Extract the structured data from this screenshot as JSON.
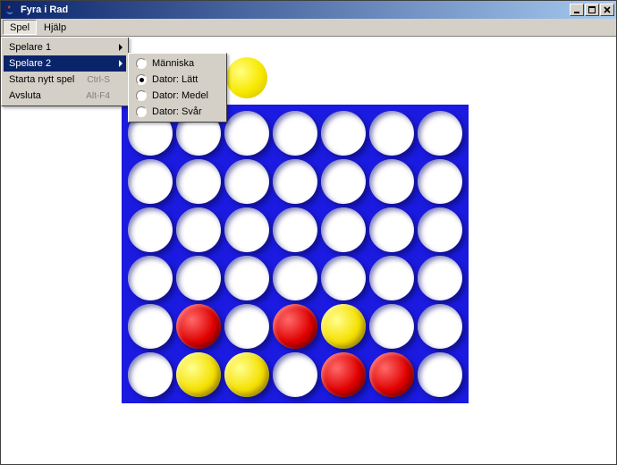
{
  "window": {
    "title": "Fyra i Rad"
  },
  "menubar": {
    "spel": "Spel",
    "hjalp": "Hjälp"
  },
  "spel_menu": {
    "player1": "Spelare 1",
    "player2": "Spelare 2",
    "new_game": "Starta nytt spel",
    "new_game_accel": "Ctrl-S",
    "quit": "Avsluta",
    "quit_accel": "Alt-F4"
  },
  "player2_submenu": {
    "human": "Människa",
    "easy": "Dator: Lätt",
    "medium": "Dator: Medel",
    "hard": "Dator: Svår",
    "selected": "easy"
  },
  "game": {
    "hover_column": 2,
    "hover_color": "yellow",
    "colors": {
      "board": "#1a1ae0",
      "red": "#e00000",
      "yellow": "#f5e000"
    },
    "board": [
      [
        "empty",
        "empty",
        "empty",
        "empty",
        "empty",
        "empty",
        "empty"
      ],
      [
        "empty",
        "empty",
        "empty",
        "empty",
        "empty",
        "empty",
        "empty"
      ],
      [
        "empty",
        "empty",
        "empty",
        "empty",
        "empty",
        "empty",
        "empty"
      ],
      [
        "empty",
        "empty",
        "empty",
        "empty",
        "empty",
        "empty",
        "empty"
      ],
      [
        "empty",
        "red",
        "empty",
        "red",
        "yellow",
        "empty",
        "empty"
      ],
      [
        "empty",
        "yellow",
        "yellow",
        "empty",
        "red",
        "red",
        "empty"
      ]
    ]
  }
}
